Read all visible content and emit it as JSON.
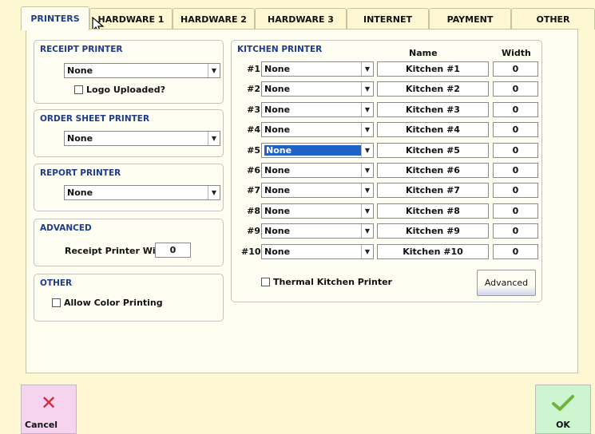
{
  "tabs": [
    {
      "label": "PRINTERS",
      "active": true
    },
    {
      "label": "HARDWARE 1"
    },
    {
      "label": "HARDWARE 2"
    },
    {
      "label": "HARDWARE 3"
    },
    {
      "label": "INTERNET"
    },
    {
      "label": "PAYMENT"
    },
    {
      "label": "OTHER"
    }
  ],
  "receipt": {
    "title": "RECEIPT PRINTER",
    "value": "None",
    "logo_label": "Logo Uploaded?"
  },
  "order_sheet": {
    "title": "ORDER SHEET PRINTER",
    "value": "None"
  },
  "report": {
    "title": "REPORT PRINTER",
    "value": "None"
  },
  "advanced": {
    "title": "ADVANCED",
    "width_label": "Receipt Printer Width",
    "width_value": "0"
  },
  "other": {
    "title": "OTHER",
    "color_label": "Allow Color Printing"
  },
  "kitchen": {
    "title": "KITCHEN PRINTER",
    "name_header": "Name",
    "width_header": "Width",
    "rows": [
      {
        "num": "#1",
        "value": "None",
        "name": "Kitchen #1",
        "width": "0"
      },
      {
        "num": "#2",
        "value": "None",
        "name": "Kitchen #2",
        "width": "0"
      },
      {
        "num": "#3",
        "value": "None",
        "name": "Kitchen #3",
        "width": "0"
      },
      {
        "num": "#4",
        "value": "None",
        "name": "Kitchen #4",
        "width": "0"
      },
      {
        "num": "#5",
        "value": "None",
        "name": "Kitchen #5",
        "width": "0"
      },
      {
        "num": "#6",
        "value": "None",
        "name": "Kitchen #6",
        "width": "0"
      },
      {
        "num": "#7",
        "value": "None",
        "name": "Kitchen #7",
        "width": "0"
      },
      {
        "num": "#8",
        "value": "None",
        "name": "Kitchen #8",
        "width": "0"
      },
      {
        "num": "#9",
        "value": "None",
        "name": "Kitchen #9",
        "width": "0"
      },
      {
        "num": "#10",
        "value": "None",
        "name": "Kitchen #10",
        "width": "0"
      }
    ],
    "thermal_label": "Thermal Kitchen Printer",
    "advanced_label": "Advanced"
  },
  "footer": {
    "cancel_label": "Cancel",
    "ok_label": "OK"
  },
  "colors": {
    "accent": "#1f3c8a",
    "selected": "#1e62c8",
    "background": "#fdf8d2",
    "cancel_bg": "#f6d3ee",
    "ok_bg": "#cdf5cf"
  }
}
